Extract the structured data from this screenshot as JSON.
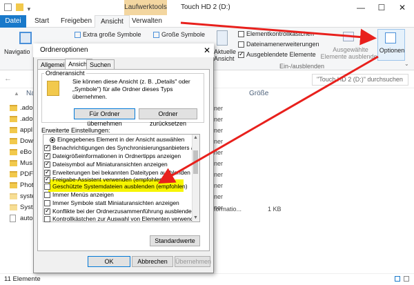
{
  "window": {
    "title": "Touch HD 2 (D:)",
    "contextual_tab": "Laufwerktools",
    "minimize": "—",
    "maximize": "☐",
    "close": "✕"
  },
  "ribbon_tabs": [
    "Datei",
    "Start",
    "Freigeben",
    "Ansicht",
    "Verwalten"
  ],
  "ribbon": {
    "navigation_label": "Navigatio",
    "extra_large_icons": "Extra große Symbole",
    "large_icons": "Große Symbole",
    "current_view": "Aktuelle Ansicht",
    "item_checkboxes": "Elementkontrollkästchen",
    "file_extensions": "Dateinamenerweiterungen",
    "hidden_items": "Ausgeblendete Elemente",
    "hide_selected": "Ausgewählte Elemente ausblenden",
    "options": "Optionen",
    "group_show_hide": "Ein-/ausblenden"
  },
  "address": {
    "search_placeholder": "\"Touch HD 2 (D:)\" durchsuchen"
  },
  "filelist": {
    "col_name": "Name",
    "col_size": "Größe",
    "items": [
      ".ado",
      ".ado",
      "appl",
      "Dow",
      "eBo",
      "Mus",
      "PDF",
      "Phot",
      "syste",
      "Syst",
      "auto"
    ],
    "right_values": [
      "ner",
      "ner",
      "ner",
      "ner",
      "ner",
      "ner",
      "ner",
      "ner",
      "ner",
      "ner",
      "formatio..."
    ],
    "auto_size": "1 KB"
  },
  "status": {
    "count": "11 Elemente"
  },
  "dialog": {
    "title": "Ordneroptionen",
    "tabs": [
      "Allgemein",
      "Ansicht",
      "Suchen"
    ],
    "group_title": "Ordneransicht",
    "group_text": "Sie können diese Ansicht (z. B. „Details\" oder „Symbole\") für alle Ordner dieses Typs übernehmen.",
    "apply_to_folders": "Für Ordner übernehmen",
    "reset_folders": "Ordner zurücksetzen",
    "advanced_label": "Erweiterte Einstellungen:",
    "settings": [
      {
        "label": "Eingegebenes Element in der Ansicht auswählen",
        "kind": "radio",
        "checked": true
      },
      {
        "label": "Benachrichtigungen des Synchronisierungsanbieters anzeigen",
        "kind": "check",
        "checked": true
      },
      {
        "label": "Dateigrößeinformationen in Ordnertipps anzeigen",
        "kind": "check",
        "checked": true
      },
      {
        "label": "Dateisymbol auf Miniaturansichten anzeigen",
        "kind": "check",
        "checked": true
      },
      {
        "label": "Erweiterungen bei bekannten Dateitypen ausblenden",
        "kind": "check",
        "checked": true
      },
      {
        "label": "Freigabe-Assistent verwenden (empfohlen)",
        "kind": "check",
        "checked": true
      },
      {
        "label": "Geschützte Systemdateien ausblenden (empfohlen)",
        "kind": "check",
        "checked": false
      },
      {
        "label": "Immer Menüs anzeigen",
        "kind": "check",
        "checked": false
      },
      {
        "label": "Immer Symbole statt Miniaturansichten anzeigen",
        "kind": "check",
        "checked": false
      },
      {
        "label": "Konflikte bei der Ordnerzusammenführung ausblenden",
        "kind": "check",
        "checked": true
      },
      {
        "label": "Kontrollkästchen zur Auswahl von Elementen verwenden",
        "kind": "check",
        "checked": false
      }
    ],
    "restore_defaults": "Standardwerte",
    "ok": "OK",
    "cancel": "Abbrechen",
    "apply": "Übernehmen"
  },
  "colors": {
    "accent": "#1979ca",
    "highlight": "#f7f500",
    "arrow": "#e8201c"
  }
}
